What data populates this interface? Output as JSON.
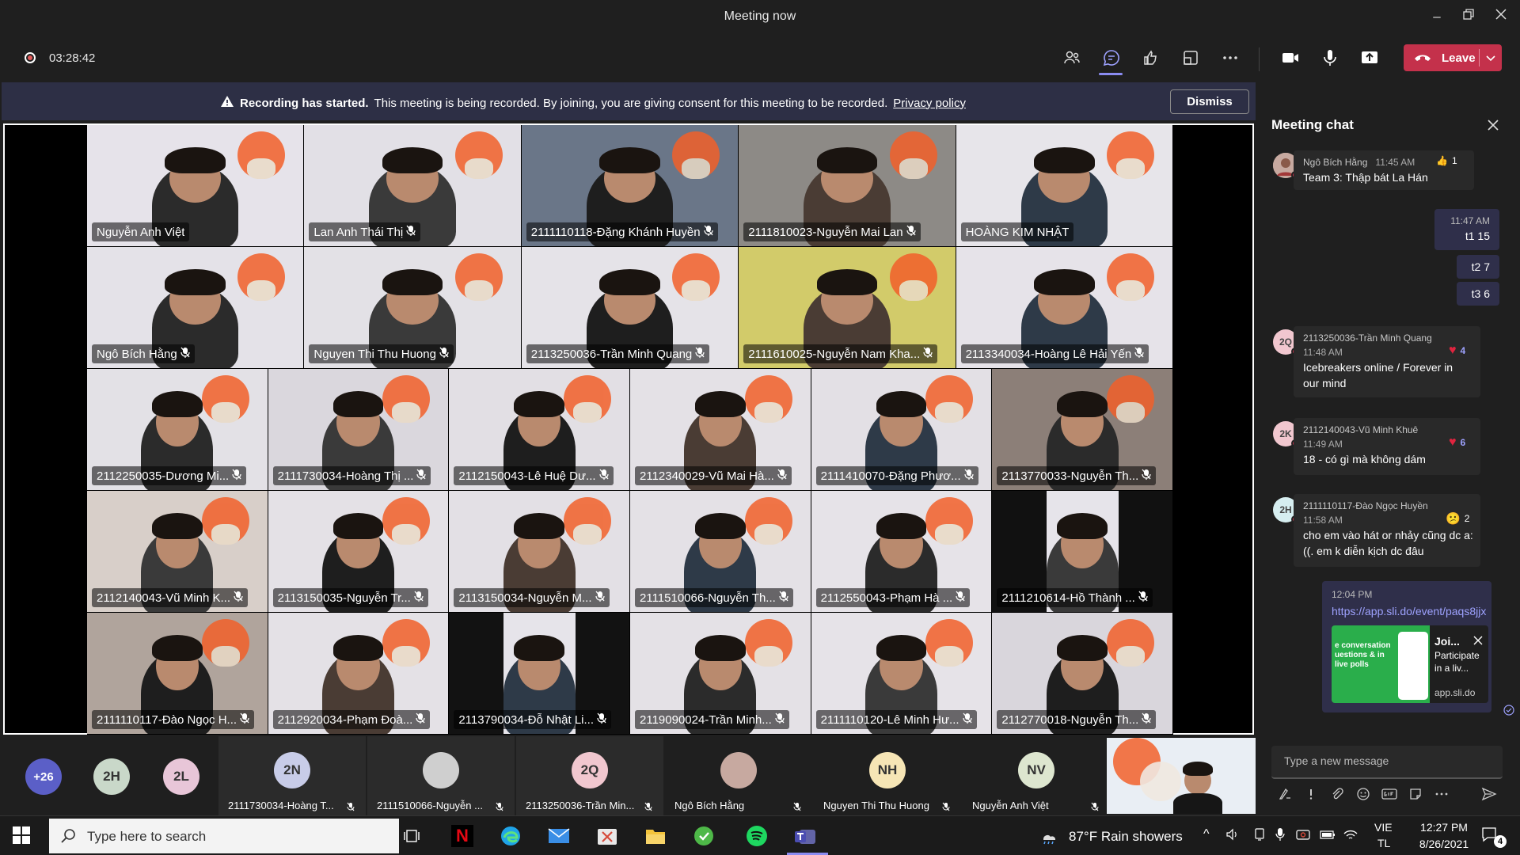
{
  "window": {
    "title": "Meeting now"
  },
  "toolbar": {
    "timer": "03:28:42",
    "leave_label": "Leave"
  },
  "banner": {
    "bold": "Recording has started.",
    "text": "This meeting is being recorded. By joining, you are giving consent for this meeting to be recorded.",
    "link": "Privacy policy",
    "dismiss_label": "Dismiss"
  },
  "tiles": [
    {
      "name": "Nguyễn Anh Việt",
      "muted": false,
      "bg": "#e6e3ea"
    },
    {
      "name": "Lan Anh Thái Thị",
      "muted": true,
      "bg": "#e2e0e6"
    },
    {
      "name": "2111110118-Đặng Khánh Huyền",
      "muted": true,
      "bg": "#6a7688"
    },
    {
      "name": "2111810023-Nguyễn Mai Lan",
      "muted": true,
      "bg": "#8d8a86"
    },
    {
      "name": "HOÀNG KIM NHẬT",
      "muted": false,
      "bg": "#e7e5ea"
    },
    {
      "name": "Ngô Bích Hằng",
      "muted": true,
      "bg": "#e4e2e8"
    },
    {
      "name": "Nguyen Thi Thu Huong",
      "muted": true,
      "bg": "#e3e1e6"
    },
    {
      "name": "2113250036-Trần Minh Quang",
      "muted": true,
      "bg": "#e5e3e8"
    },
    {
      "name": "2111610025-Nguyễn Nam Kha...",
      "muted": true,
      "bg": "#d2cb6a"
    },
    {
      "name": "2113340034-Hoàng Lê Hải Yến",
      "muted": true,
      "bg": "#e6e3e9"
    },
    {
      "name": "2112250035-Dương Mi...",
      "muted": true,
      "bg": "#e3e1e6"
    },
    {
      "name": "2111730034-Hoàng Thị ...",
      "muted": true,
      "bg": "#dad7dd"
    },
    {
      "name": "2112150043-Lê Huệ Dư...",
      "muted": true,
      "bg": "#e2dfe4"
    },
    {
      "name": "2112340029-Vũ Mai Hà...",
      "muted": true,
      "bg": "#e4e1e6"
    },
    {
      "name": "2111410070-Đặng Phươ...",
      "muted": true,
      "bg": "#e3e0e5"
    },
    {
      "name": "2113770033-Nguyễn Th...",
      "muted": true,
      "bg": "#8c7f78"
    },
    {
      "name": "2112140043-Vũ Minh K...",
      "muted": true,
      "bg": "#d8cfc9"
    },
    {
      "name": "2113150035-Nguyễn Tr...",
      "muted": true,
      "bg": "#e4e1e6"
    },
    {
      "name": "2113150034-Nguyễn M...",
      "muted": true,
      "bg": "#e3e0e5"
    },
    {
      "name": "2111510066-Nguyễn Th...",
      "muted": true,
      "bg": "#e4e1e6"
    },
    {
      "name": "2112550043-Phạm Hà ...",
      "muted": true,
      "bg": "#e6e3e8"
    },
    {
      "name": "2111210614-Hồ Thành ...",
      "muted": true,
      "bg": "#111111"
    },
    {
      "name": "2111110117-Đào Ngọc H...",
      "muted": true,
      "bg": "#b0a49c"
    },
    {
      "name": "2112920034-Phạm Đoà...",
      "muted": true,
      "bg": "#e4e1e6"
    },
    {
      "name": "2113790034-Đỗ Nhật Li...",
      "muted": true,
      "bg": "#121212"
    },
    {
      "name": "2119090024-Trần Minh...",
      "muted": true,
      "bg": "#e4e1e6"
    },
    {
      "name": "2111110120-Lê Minh Hư...",
      "muted": true,
      "bg": "#e6e3e8"
    },
    {
      "name": "2112770018-Nguyễn Th...",
      "muted": true,
      "bg": "#d9d6dc"
    }
  ],
  "strip": {
    "overflow": "+26",
    "circles": [
      {
        "initials": "2H",
        "color": "#c9d8c9"
      },
      {
        "initials": "2L",
        "color": "#e8c6d8"
      }
    ],
    "participants": [
      {
        "initials": "2N",
        "name": "2111730034-Hoàng T...",
        "color": "#c8cce8"
      },
      {
        "initials": "",
        "name": "2111510066-Nguyễn ...",
        "color": "#cfcfcf"
      },
      {
        "initials": "2Q",
        "name": "2113250036-Trần Min...",
        "color": "#f1c7cf"
      },
      {
        "initials": "",
        "name": "Ngô Bích Hằng",
        "color": "#c7a9a0"
      },
      {
        "initials": "NH",
        "name": "Nguyen Thi Thu Huong",
        "color": "#f6e5b5"
      },
      {
        "initials": "NV",
        "name": "Nguyễn Anh Việt",
        "color": "#dde6cf"
      }
    ]
  },
  "chat": {
    "title": "Meeting chat",
    "messages": [
      {
        "author": "Ngô Bích Hằng",
        "time": "11:45 AM",
        "text": "Team 3: Thập bát La Hán",
        "reaction": "1",
        "initials": ""
      },
      {
        "author": "2113250036-Trần Minh Quang",
        "time": "11:48 AM",
        "text": "Icebreakers online / Forever in our mind",
        "reaction": "4",
        "initials": "2Q"
      },
      {
        "author": "2112140043-Vũ Minh Khuê",
        "time": "11:49 AM",
        "text": "18 - có gì mà không dám",
        "reaction": "6",
        "initials": "2K"
      },
      {
        "author": "2111110117-Đào Ngọc Huyền",
        "time": "11:58 AM",
        "text": "cho em vào hát or nhảy cũng dc a:((. em k diễn kịch dc đâu",
        "reaction": "2",
        "initials": "2H"
      }
    ],
    "mine": {
      "time": "11:47 AM",
      "lines": [
        "t1 15",
        "t2 7",
        "t3 6"
      ]
    },
    "link": {
      "time": "12:04 PM",
      "url": "https://app.sli.do/event/paqs8jjx",
      "thumb_text": "e conversation uestions & in live polls",
      "title": "Joi...",
      "desc": "Participate in a liv...",
      "domain": "app.sli.do"
    },
    "compose_placeholder": "Type a new message"
  },
  "taskbar": {
    "search_placeholder": "Type here to search",
    "weather": "87°F  Rain showers",
    "lang_top": "VIE",
    "lang_bottom": "TL",
    "time": "12:27 PM",
    "date": "8/26/2021",
    "notif_count": "4"
  },
  "colors": {
    "leave": "#c4314b",
    "accent": "#8b8cf2",
    "banner": "#2d2f45",
    "link": "#9ea2ff"
  }
}
